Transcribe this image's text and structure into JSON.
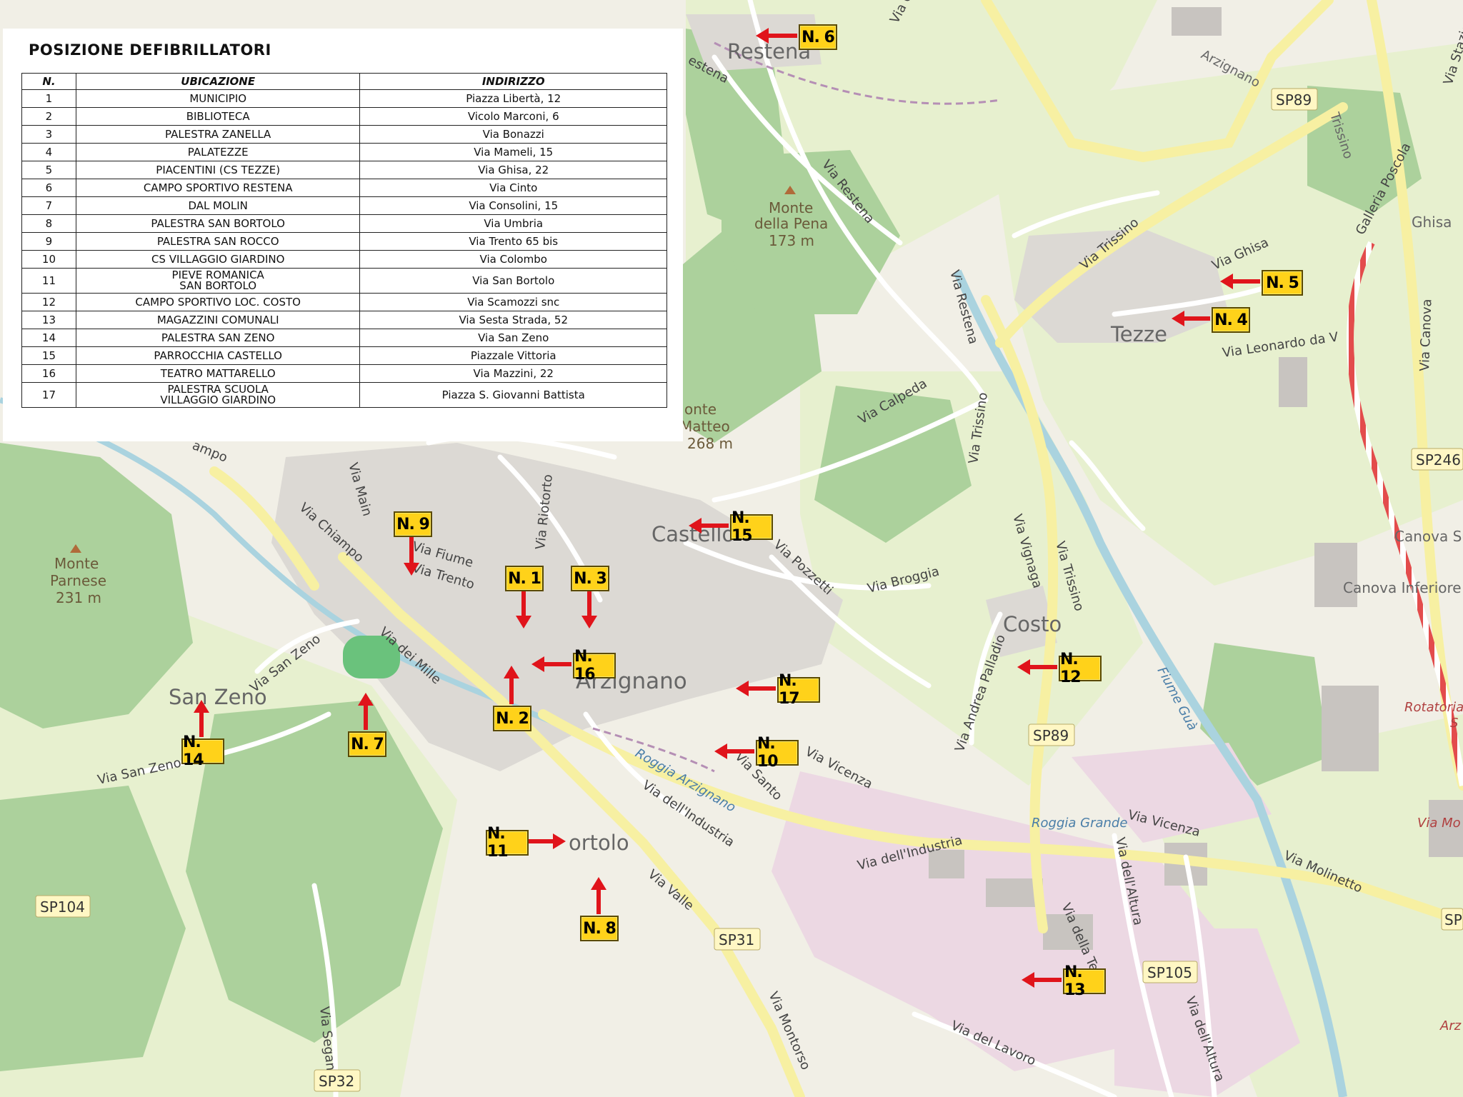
{
  "table": {
    "title": "POSIZIONE DEFIBRILLATORI",
    "headers": [
      "N.",
      "UBICAZIONE",
      "INDIRIZZO"
    ],
    "rows": [
      {
        "n": "1",
        "ubicazione": "MUNICIPIO",
        "indirizzo": "Piazza Libertà, 12"
      },
      {
        "n": "2",
        "ubicazione": "BIBLIOTECA",
        "indirizzo": "Vicolo Marconi, 6"
      },
      {
        "n": "3",
        "ubicazione": "PALESTRA ZANELLA",
        "indirizzo": "Via Bonazzi"
      },
      {
        "n": "4",
        "ubicazione": "PALATEZZE",
        "indirizzo": "Via Mameli, 15"
      },
      {
        "n": "5",
        "ubicazione": "PIACENTINI (CS TEZZE)",
        "indirizzo": "Via Ghisa, 22"
      },
      {
        "n": "6",
        "ubicazione": "CAMPO SPORTIVO RESTENA",
        "indirizzo": "Via Cinto"
      },
      {
        "n": "7",
        "ubicazione": "DAL MOLIN",
        "indirizzo": "Via Consolini, 15"
      },
      {
        "n": "8",
        "ubicazione": "PALESTRA SAN BORTOLO",
        "indirizzo": "Via Umbria"
      },
      {
        "n": "9",
        "ubicazione": "PALESTRA SAN ROCCO",
        "indirizzo": "Via Trento 65 bis"
      },
      {
        "n": "10",
        "ubicazione": "CS VILLAGGIO GIARDINO",
        "indirizzo": "Via Colombo"
      },
      {
        "n": "11",
        "ubicazione": "PIEVE ROMANICA SAN BORTOLO",
        "ubicazione_l1": "PIEVE ROMANICA",
        "ubicazione_l2": "SAN BORTOLO",
        "indirizzo": "Via San Bortolo"
      },
      {
        "n": "12",
        "ubicazione": "CAMPO SPORTIVO LOC. COSTO",
        "indirizzo": "Via Scamozzi snc"
      },
      {
        "n": "13",
        "ubicazione": "MAGAZZINI COMUNALI",
        "indirizzo": "Via Sesta Strada, 52"
      },
      {
        "n": "14",
        "ubicazione": "PALESTRA SAN ZENO",
        "indirizzo": "Via San Zeno"
      },
      {
        "n": "15",
        "ubicazione": "PARROCCHIA CASTELLO",
        "indirizzo": "Piazzale Vittoria"
      },
      {
        "n": "16",
        "ubicazione": "TEATRO MATTARELLO",
        "indirizzo": "Via Mazzini, 22"
      },
      {
        "n": "17",
        "ubicazione": "PALESTRA SCUOLA VILLAGGIO GIARDINO",
        "ubicazione_l1": "PALESTRA SCUOLA",
        "ubicazione_l2": "VILLAGGIO GIARDINO",
        "indirizzo": "Piazza S. Giovanni Battista"
      }
    ]
  },
  "markers": [
    {
      "id": "N. 1",
      "label": "N. 1"
    },
    {
      "id": "N. 2",
      "label": "N. 2"
    },
    {
      "id": "N. 3",
      "label": "N. 3"
    },
    {
      "id": "N. 4",
      "label": "N. 4"
    },
    {
      "id": "N. 5",
      "label": "N. 5"
    },
    {
      "id": "N. 6",
      "label": "N. 6"
    },
    {
      "id": "N. 7",
      "label": "N. 7"
    },
    {
      "id": "N. 8",
      "label": "N. 8"
    },
    {
      "id": "N. 9",
      "label": "N. 9"
    },
    {
      "id": "N. 10",
      "label": "N. 10"
    },
    {
      "id": "N. 11",
      "label": "N. 11"
    },
    {
      "id": "N. 12",
      "label": "N. 12"
    },
    {
      "id": "N. 13",
      "label": "N. 13"
    },
    {
      "id": "N. 14",
      "label": "N. 14"
    },
    {
      "id": "N. 15",
      "label": "N. 15"
    },
    {
      "id": "N. 16",
      "label": "N. 16"
    },
    {
      "id": "N. 17",
      "label": "N. 17"
    }
  ],
  "places": {
    "restena": "Restena",
    "tezze": "Tezze",
    "castello": "Castello",
    "arzignano": "Arzignano",
    "san_zeno": "San Zeno",
    "costo": "Costo",
    "bortolo": "ortolo",
    "ghisa": "Ghisa",
    "canova_su": "Canova Su",
    "canova_inferiore": "Canova Inferiore",
    "rotatoria": "Rotatoria",
    "rotatoria_s": "S",
    "via_mo": "Via Mo",
    "arz": "Arz"
  },
  "peaks": {
    "pena_l1": "Monte",
    "pena_l2": "della Pena",
    "pena_l3": "173 m",
    "parnese_l1": "Monte",
    "parnese_l2": "Parnese",
    "parnese_l3": "231 m",
    "matteo_l1": "onte",
    "matteo_l2": "Matteo",
    "matteo_l3": "268 m"
  },
  "roads": {
    "sp89_a": "SP89",
    "sp89_b": "SP89",
    "sp246": "SP246",
    "sp104": "SP104",
    "sp31": "SP31",
    "sp32": "SP32",
    "sp105": "SP105",
    "sp_edge": "SP"
  },
  "streets": {
    "restena_top": "estena",
    "arzignano": "Arzignano",
    "trissino": "Trissino",
    "galleria": "Galleria Poscola",
    "via_stazione": "Via Stazione",
    "via_restena_1": "Via Restena",
    "via_restena_2": "Via Restena",
    "via_trissino_1": "Via Trissino",
    "via_trissino_2": "Via Trissino",
    "via_trissino_3": "Via Trissino",
    "via_ghisa": "Via Ghisa",
    "via_leonardo": "Via Leonardo da V",
    "via_canova": "Via Canova",
    "via_calpeda": "Via Calpeda",
    "via_broggia": "Via Broggia",
    "via_vignaga": "Via Vignaga",
    "via_pozzetti": "Via Pozzetti",
    "via_palladio": "Via Andrea Palladio",
    "fiume_guà": "Fiume Guà",
    "via_vicenza_1": "Via Vicenza",
    "via_vicenza_2": "Via Vicenza",
    "roggia_grande": "Roggia Grande",
    "via_molinetto": "Via Molinetto",
    "via_altura_1": "Via dell'Altura",
    "via_altura_2": "Via dell'Altura",
    "via_terza": "Via della Terza",
    "via_lavoro": "Via del Lavoro",
    "via_industria_1": "Via dell'Industria",
    "via_industria_2": "Via dell'Industria",
    "roggia_arz": "Roggia Arzignano",
    "via_santo": "Via Santo",
    "via_valle": "Via Valle",
    "via_montorso": "Via Montorso",
    "via_segan": "Via Segan",
    "via_san_zeno_1": "Via San Zeno",
    "via_san_zeno_2": "Via San Zeno",
    "via_mille": "Via dei Mille",
    "via_chiampo": "Via Chiampo",
    "via_main": "Via Main",
    "via_fiume": "Via Fiume",
    "via_trento": "Via Trento",
    "via_riotorto": "Via Riotorto",
    "via_cinto": "Via C",
    "ampo": "ampo"
  }
}
